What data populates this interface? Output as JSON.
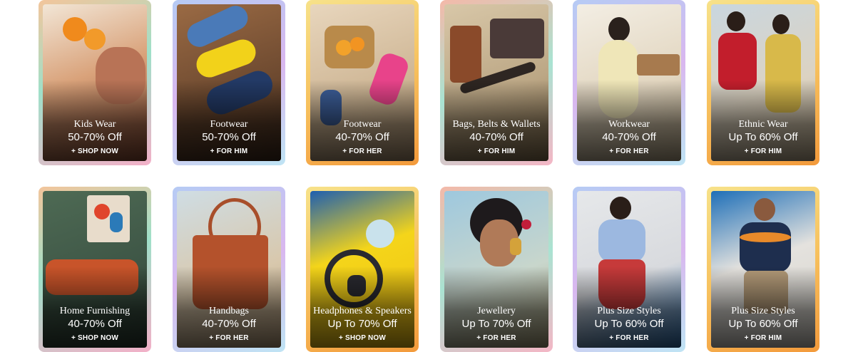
{
  "tiles": [
    {
      "category": "Kids Wear",
      "offer": "50-70% Off",
      "cta": "+ SHOP NOW"
    },
    {
      "category": "Footwear",
      "offer": "50-70% Off",
      "cta": "+ FOR HIM"
    },
    {
      "category": "Footwear",
      "offer": "40-70% Off",
      "cta": "+ FOR HER"
    },
    {
      "category": "Bags, Belts & Wallets",
      "offer": "40-70% Off",
      "cta": "+ FOR HIM"
    },
    {
      "category": "Workwear",
      "offer": "40-70% Off",
      "cta": "+ FOR HER"
    },
    {
      "category": "Ethnic Wear",
      "offer": "Up To 60% Off",
      "cta": "+ FOR HIM"
    },
    {
      "category": "Home Furnishing",
      "offer": "40-70% Off",
      "cta": "+ SHOP NOW"
    },
    {
      "category": "Handbags",
      "offer": "40-70% Off",
      "cta": "+ FOR HER"
    },
    {
      "category": "Headphones & Speakers",
      "offer": "Up To 70% Off",
      "cta": "+ SHOP NOW"
    },
    {
      "category": "Jewellery",
      "offer": "Up To 70% Off",
      "cta": "+ FOR HER"
    },
    {
      "category": "Plus Size Styles",
      "offer": "Up To 60% Off",
      "cta": "+ FOR HER"
    },
    {
      "category": "Plus Size Styles",
      "offer": "Up To 60% Off",
      "cta": "+ FOR HIM"
    }
  ]
}
